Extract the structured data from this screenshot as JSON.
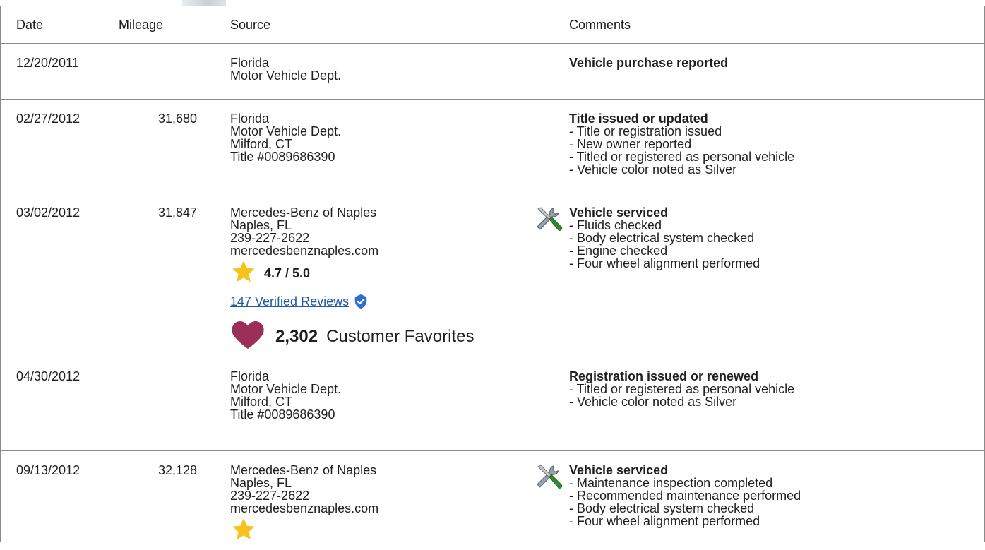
{
  "table": {
    "headers": {
      "date": "Date",
      "mileage": "Mileage",
      "source": "Source",
      "comments": "Comments"
    },
    "rows": [
      {
        "date": "12/20/2011",
        "mileage": "",
        "source": [
          "Florida",
          "Motor Vehicle Dept."
        ],
        "comment_title": "Vehicle purchase reported",
        "comment_items": []
      },
      {
        "date": "02/27/2012",
        "mileage": "31,680",
        "source": [
          "Florida",
          "Motor Vehicle Dept.",
          "Milford, CT",
          "Title #0089686390"
        ],
        "comment_title": "Title issued or updated",
        "comment_items": [
          "- Title or registration issued",
          "- New owner reported",
          "- Titled or registered as personal vehicle",
          "- Vehicle color noted as Silver"
        ]
      },
      {
        "date": "03/02/2012",
        "mileage": "31,847",
        "source": [
          "Mercedes-Benz of Naples",
          "Naples, FL",
          "239-227-2622",
          "mercedesbenznaples.com"
        ],
        "rating": "4.7 / 5.0",
        "reviews_link": "147 Verified Reviews",
        "favorites_count": "2,302",
        "favorites_label": "Customer Favorites",
        "comment_icon": "service-tools-icon",
        "comment_title": "Vehicle serviced",
        "comment_items": [
          "- Fluids checked",
          "- Body electrical system checked",
          "- Engine checked",
          "- Four wheel alignment performed"
        ]
      },
      {
        "date": "04/30/2012",
        "mileage": "",
        "source": [
          "Florida",
          "Motor Vehicle Dept.",
          "Milford, CT",
          "Title #0089686390"
        ],
        "comment_title": "Registration issued or renewed",
        "comment_items": [
          "- Titled or registered as personal vehicle",
          "- Vehicle color noted as Silver"
        ]
      },
      {
        "date": "09/13/2012",
        "mileage": "32,128",
        "source": [
          "Mercedes-Benz of Naples",
          "Naples, FL",
          "239-227-2622",
          "mercedesbenznaples.com"
        ],
        "comment_icon": "service-tools-icon",
        "comment_title": "Vehicle serviced",
        "comment_items": [
          "- Maintenance inspection completed",
          "- Recommended maintenance performed",
          "- Body electrical system checked",
          "- Four wheel alignment performed"
        ]
      }
    ]
  },
  "colors": {
    "star": "#f7c31b",
    "heart": "#9c2f57",
    "verified": "#2f6fd1",
    "link": "#1e5aa8",
    "border": "#8a8a8a"
  }
}
